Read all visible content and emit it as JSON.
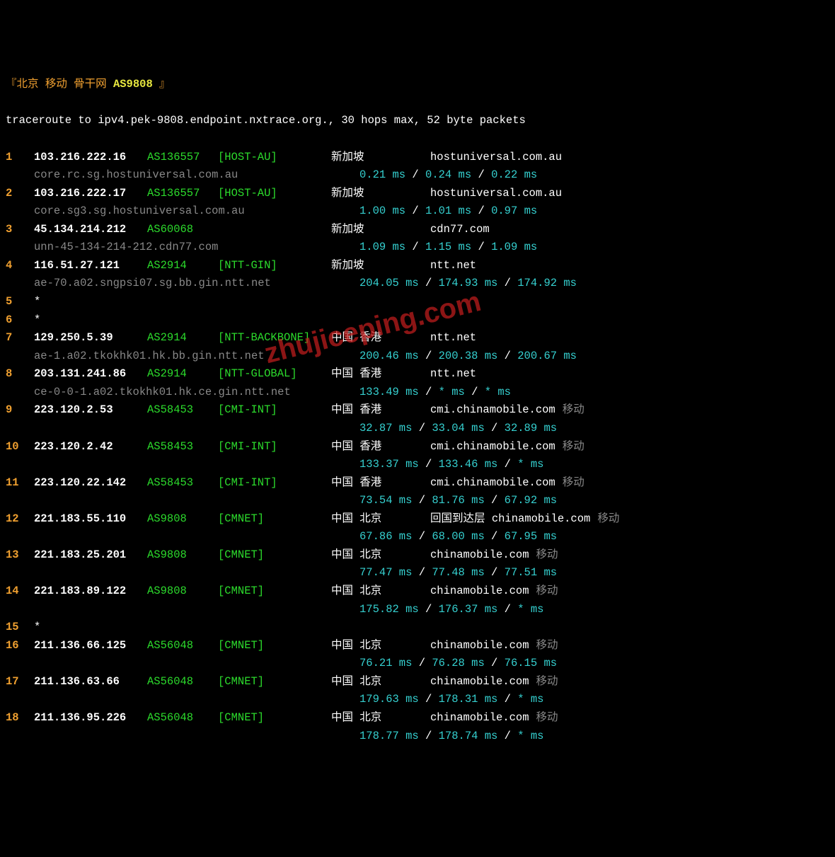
{
  "header": {
    "prefix": "『",
    "title": "北京 移动 骨干网",
    "asn": "AS9808",
    "suffix": " 』"
  },
  "trace_cmd": "traceroute to ipv4.pek-9808.endpoint.nxtrace.org., 30 hops max, 52 byte packets",
  "watermark": "zhujiceping.com",
  "hops": [
    {
      "num": "1",
      "ip": "103.216.222.16",
      "asn": "AS136557",
      "tag": "[HOST-AU]",
      "loc": "新加坡",
      "host": "hostuniversal.com.au",
      "extra": "",
      "rdns": "core.rc.sg.hostuniversal.com.au",
      "lat": [
        "0.21 ms",
        "0.24 ms",
        "0.22 ms"
      ]
    },
    {
      "num": "2",
      "ip": "103.216.222.17",
      "asn": "AS136557",
      "tag": "[HOST-AU]",
      "loc": "新加坡",
      "host": "hostuniversal.com.au",
      "extra": "",
      "rdns": "core.sg3.sg.hostuniversal.com.au",
      "lat": [
        "1.00 ms",
        "1.01 ms",
        "0.97 ms"
      ]
    },
    {
      "num": "3",
      "ip": "45.134.214.212",
      "asn": "AS60068",
      "tag": "",
      "loc": "新加坡",
      "host": "cdn77.com",
      "extra": "",
      "rdns": "unn-45-134-214-212.cdn77.com",
      "lat": [
        "1.09 ms",
        "1.15 ms",
        "1.09 ms"
      ]
    },
    {
      "num": "4",
      "ip": "116.51.27.121",
      "asn": "AS2914",
      "tag": "[NTT-GIN]",
      "loc": "新加坡",
      "host": "ntt.net",
      "extra": "",
      "rdns": "ae-70.a02.sngpsi07.sg.bb.gin.ntt.net",
      "lat": [
        "204.05 ms",
        "174.93 ms",
        "174.92 ms"
      ]
    },
    {
      "num": "5",
      "ip": "*",
      "timeout": true
    },
    {
      "num": "6",
      "ip": "*",
      "timeout": true
    },
    {
      "num": "7",
      "ip": "129.250.5.39",
      "asn": "AS2914",
      "tag": "[NTT-BACKBONE]",
      "loc": "中国 香港",
      "host": "ntt.net",
      "extra": "",
      "rdns": "ae-1.a02.tkokhk01.hk.bb.gin.ntt.net",
      "lat": [
        "200.46 ms",
        "200.38 ms",
        "200.67 ms"
      ]
    },
    {
      "num": "8",
      "ip": "203.131.241.86",
      "asn": "AS2914",
      "tag": "[NTT-GLOBAL]",
      "loc": "中国 香港",
      "host": "ntt.net",
      "extra": "",
      "rdns": "ce-0-0-1.a02.tkokhk01.hk.ce.gin.ntt.net",
      "lat": [
        "133.49 ms",
        "* ms",
        "* ms"
      ]
    },
    {
      "num": "9",
      "ip": "223.120.2.53",
      "asn": "AS58453",
      "tag": "[CMI-INT]",
      "loc": "中国 香港",
      "host": "cmi.chinamobile.com",
      "extra": "移动",
      "rdns": "",
      "lat": [
        "32.87 ms",
        "33.04 ms",
        "32.89 ms"
      ]
    },
    {
      "num": "10",
      "ip": "223.120.2.42",
      "asn": "AS58453",
      "tag": "[CMI-INT]",
      "loc": "中国 香港",
      "host": "cmi.chinamobile.com",
      "extra": "移动",
      "rdns": "",
      "lat": [
        "133.37 ms",
        "133.46 ms",
        "* ms"
      ]
    },
    {
      "num": "11",
      "ip": "223.120.22.142",
      "asn": "AS58453",
      "tag": "[CMI-INT]",
      "loc": "中国 香港",
      "host": "cmi.chinamobile.com",
      "extra": "移动",
      "rdns": "",
      "lat": [
        "73.54 ms",
        "81.76 ms",
        "67.92 ms"
      ]
    },
    {
      "num": "12",
      "ip": "221.183.55.110",
      "asn": "AS9808",
      "tag": "[CMNET]",
      "loc": "中国 北京",
      "prehost": "回国到达层 ",
      "host": "chinamobile.com",
      "extra": "移动",
      "rdns": "",
      "lat": [
        "67.86 ms",
        "68.00 ms",
        "67.95 ms"
      ]
    },
    {
      "num": "13",
      "ip": "221.183.25.201",
      "asn": "AS9808",
      "tag": "[CMNET]",
      "loc": "中国 北京",
      "host": "chinamobile.com",
      "extra": "移动",
      "rdns": "",
      "lat": [
        "77.47 ms",
        "77.48 ms",
        "77.51 ms"
      ]
    },
    {
      "num": "14",
      "ip": "221.183.89.122",
      "asn": "AS9808",
      "tag": "[CMNET]",
      "loc": "中国 北京",
      "host": "chinamobile.com",
      "extra": "移动",
      "rdns": "",
      "lat": [
        "175.82 ms",
        "176.37 ms",
        "* ms"
      ]
    },
    {
      "num": "15",
      "ip": "*",
      "timeout": true
    },
    {
      "num": "16",
      "ip": "211.136.66.125",
      "asn": "AS56048",
      "tag": "[CMNET]",
      "loc": "中国 北京",
      "host": "chinamobile.com",
      "extra": "移动",
      "rdns": "",
      "lat": [
        "76.21 ms",
        "76.28 ms",
        "76.15 ms"
      ]
    },
    {
      "num": "17",
      "ip": "211.136.63.66",
      "asn": "AS56048",
      "tag": "[CMNET]",
      "loc": "中国 北京",
      "host": "chinamobile.com",
      "extra": "移动",
      "rdns": "",
      "lat": [
        "179.63 ms",
        "178.31 ms",
        "* ms"
      ]
    },
    {
      "num": "18",
      "ip": "211.136.95.226",
      "asn": "AS56048",
      "tag": "[CMNET]",
      "loc": "中国 北京",
      "host": "chinamobile.com",
      "extra": "移动",
      "rdns": "",
      "lat": [
        "178.77 ms",
        "178.74 ms",
        "* ms"
      ]
    }
  ]
}
